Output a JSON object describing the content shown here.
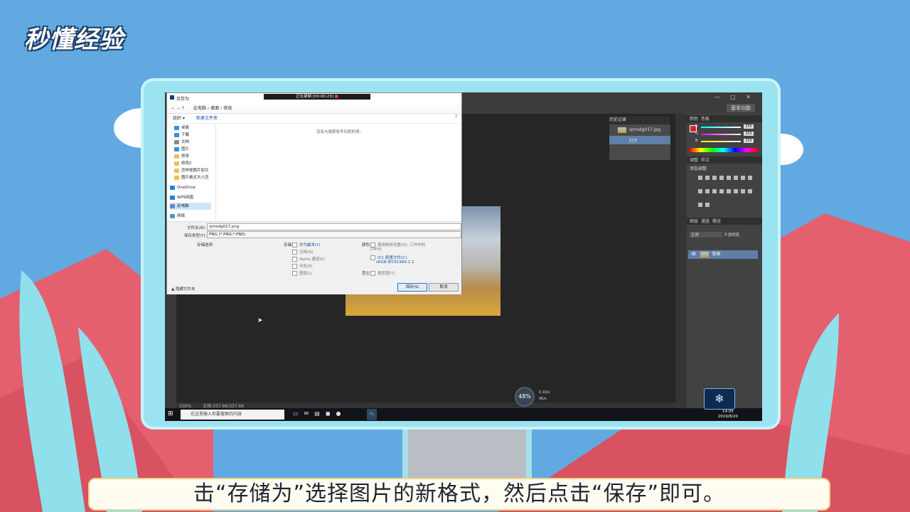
{
  "logo": {
    "text": "秒懂经验"
  },
  "caption": "击“存储为”选择图片的新格式，然后点击“保存”即可。",
  "recording": {
    "label": "正在录制 [00:00:23]"
  },
  "photoshop": {
    "workspace": "基本功能",
    "zoom": "100%",
    "doc_info": "文档:337.6K/337.6K",
    "history": {
      "tab": "历史记录",
      "snapshot": "sjmsdg017.jpg",
      "items": [
        "打开"
      ]
    },
    "color_tabs": [
      "颜色",
      "色板"
    ],
    "rgb": [
      {
        "label": "R",
        "value": "255"
      },
      {
        "label": "G",
        "value": "255"
      },
      {
        "label": "B",
        "value": "255"
      }
    ],
    "adjust_tabs": [
      "调整",
      "样式"
    ],
    "adjust_title": "添加调整",
    "layers_tabs": [
      "图层",
      "通道",
      "路径"
    ],
    "blend_mode": "正常",
    "opacity_label": "不透明度:",
    "layer_name": "背景"
  },
  "dialog": {
    "title": "另存为",
    "breadcrumb": [
      "此电脑",
      "桌面",
      "修改"
    ],
    "toolbar": {
      "organize": "组织 ▾",
      "new_folder": "新建文件夹"
    },
    "sidebar": [
      {
        "label": "桌面",
        "color": "#3b8ee0"
      },
      {
        "label": "下载",
        "color": "#3b8ee0"
      },
      {
        "label": "文档",
        "color": "#8a8a8a"
      },
      {
        "label": "图片",
        "color": "#3b8ee0"
      },
      {
        "label": "修改",
        "color": "#e8c25a"
      },
      {
        "label": "修改2",
        "color": "#e8c25a"
      },
      {
        "label": "怎样放图片如文",
        "color": "#e8c25a"
      },
      {
        "label": "图片格式大小怎",
        "color": "#e8c25a"
      },
      {
        "label": "OneDrive",
        "color": "#2c7fd6"
      },
      {
        "label": "WPS网盘",
        "color": "#2c7fd6"
      },
      {
        "label": "此电脑",
        "color": "#5a8fc6"
      },
      {
        "label": "网络",
        "color": "#5a8fc6"
      }
    ],
    "empty_message": "没有与搜索条件匹配的项。",
    "filename_label": "文件名(N):",
    "filename_value": "sjmsdg017.png",
    "filetype_label": "保存类型(T):",
    "filetype_value": "PNG (*.PNG;*.PNS)",
    "options_label": "存储选项",
    "storage_label": "存储:",
    "storage_options": [
      {
        "label": "作为副本(Y)",
        "active": true
      },
      {
        "label": "注释(N)",
        "active": false
      },
      {
        "label": "Alpha 通道(E)",
        "active": false
      },
      {
        "label": "专色(P)",
        "active": false
      },
      {
        "label": "图层(L)",
        "active": false
      }
    ],
    "color_label": "颜色:",
    "color_proof": "使用校样设置(O): 工作中的 CMYK",
    "icc_label": "ICC 配置文件(C):",
    "icc_value": "sRGB IEC61966-2.1",
    "other_label": "其它:",
    "thumbnail": "缩览图(T)",
    "hide_folders": "隐藏文件夹",
    "save_button": "保存(S)",
    "cancel_button": "取消"
  },
  "taskbar": {
    "search_placeholder": "在这里输入你要搜索的内容",
    "time": "14:05",
    "date": "2019/8/20"
  },
  "speed_widget": {
    "percent": "48%",
    "up": "0.1K/s",
    "down": "0K/s"
  }
}
